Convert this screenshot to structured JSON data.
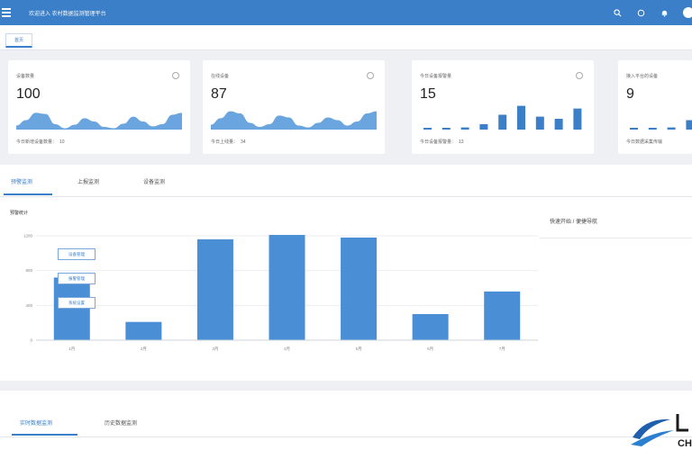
{
  "header": {
    "title": "欢迎进入 农村数据监测管理平台",
    "icons": [
      "search-icon",
      "fullscreen-icon",
      "bell-icon",
      "avatar"
    ]
  },
  "tabs": {
    "home": "首页"
  },
  "cards": [
    {
      "label": "设备数量",
      "value": "100",
      "footer_label": "今日新增设备数量：",
      "footer_value": "10",
      "spark": "area",
      "series": [
        0.15,
        0.35,
        0.62,
        0.58,
        0.2,
        0.05,
        0.18,
        0.42,
        0.3,
        0.1,
        0.05,
        0.22,
        0.48,
        0.3,
        0.12,
        0.2,
        0.55,
        0.62
      ]
    },
    {
      "label": "在线设备",
      "value": "87",
      "footer_label": "今日上线量：",
      "footer_value": "34",
      "spark": "area",
      "series": [
        0.18,
        0.42,
        0.68,
        0.6,
        0.25,
        0.1,
        0.2,
        0.52,
        0.45,
        0.15,
        0.08,
        0.25,
        0.45,
        0.35,
        0.15,
        0.3,
        0.6,
        0.68
      ]
    },
    {
      "label": "今日设备报警量",
      "value": "15",
      "footer_label": "今日设备报警量：",
      "footer_value": "13",
      "spark": "bars",
      "series": [
        0.06,
        0,
        0.08,
        0.2,
        0.55,
        0.88,
        0.48,
        0.4,
        0.78,
        0.06
      ]
    },
    {
      "label": "接入平台的设备",
      "value": "9",
      "footer_label": "今日数据采集传输",
      "footer_value": "",
      "spark": "bars",
      "series": [
        0.05,
        0,
        0.08,
        0.35,
        0.4
      ]
    }
  ],
  "panel_tabs": [
    "预警监测",
    "上报监测",
    "设备监测"
  ],
  "chart_data": {
    "type": "bar",
    "title": "预警统计",
    "categories": [
      "1月",
      "2月",
      "3月",
      "4月",
      "5月",
      "6月",
      "7月"
    ],
    "values": [
      720,
      210,
      1160,
      1210,
      1180,
      300,
      560
    ],
    "ylim": [
      0,
      1200
    ],
    "yticks": [
      "0",
      "400",
      "800",
      "1200"
    ],
    "color": "#4a8fd6",
    "grid": true
  },
  "quick": {
    "title": "快速开始 / 便捷导航",
    "buttons": [
      "设备管理",
      "报警管理",
      "系统设置"
    ]
  },
  "bottom_tabs": [
    "实时数据监测",
    "历史数据监测"
  ],
  "brand": {
    "mark": "CH"
  },
  "colors": {
    "primary": "#3a7fc8",
    "background": "#eef0f4"
  }
}
